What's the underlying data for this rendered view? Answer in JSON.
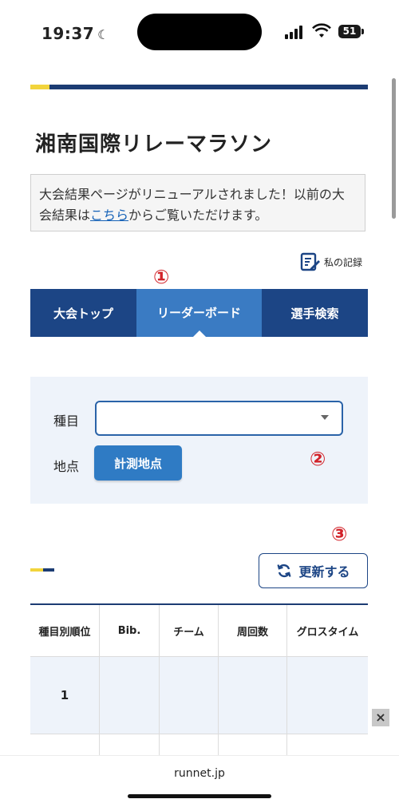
{
  "status": {
    "time": "19:37",
    "battery": "51"
  },
  "page": {
    "title": "湘南国際リレーマラソン"
  },
  "notice": {
    "text_before": "大会結果ページがリニューアルされました！以前の大会結果は",
    "link": "こちら",
    "text_after": "からご覧いただけます。"
  },
  "myrecord": {
    "label": "私の記録"
  },
  "markers": {
    "one": "①",
    "two": "②",
    "three": "③"
  },
  "tabs": [
    {
      "label": "大会トップ"
    },
    {
      "label": "リーダーボード"
    },
    {
      "label": "選手検索"
    }
  ],
  "search": {
    "event_label": "種目",
    "event_value": "",
    "point_label": "地点",
    "point_button": "計測地点"
  },
  "refresh": {
    "label": "更新する"
  },
  "table": {
    "headers": [
      "種目別順位",
      "Bib.",
      "チーム",
      "周回数",
      "グロスタイム"
    ],
    "rows": [
      {
        "rank": "1"
      }
    ]
  },
  "ad": {
    "close": "×"
  },
  "browser": {
    "url": "runnet.jp"
  },
  "colors": {
    "navy": "#1c3c73",
    "tab_bg": "#1c4585",
    "tab_active": "#3a7bc3",
    "accent": "#f2d43c",
    "marker": "#d2232a",
    "button": "#2f7bc4"
  }
}
